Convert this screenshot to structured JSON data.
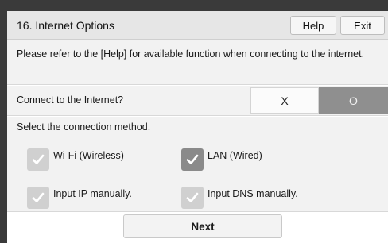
{
  "header": {
    "title": "16. Internet Options",
    "help_label": "Help",
    "exit_label": "Exit"
  },
  "info": {
    "text": "Please refer to the [Help] for available function when connecting to the internet."
  },
  "connect": {
    "label": "Connect to the Internet?",
    "off_label": "X",
    "on_label": "O",
    "selected": "O"
  },
  "method": {
    "label": "Select the connection method.",
    "options": [
      {
        "label": "Wi-Fi (Wireless)",
        "checked": false
      },
      {
        "label": "LAN (Wired)",
        "checked": true
      },
      {
        "label": "Input IP manually.",
        "checked": false
      },
      {
        "label": "Input DNS manually.",
        "checked": false
      }
    ]
  },
  "footer": {
    "next_label": "Next"
  },
  "colors": {
    "frame": "#3a3a3a",
    "panel": "#f2f2f2",
    "selected_toggle": "#8f8f8f",
    "checked_box": "#8a8a8a",
    "unchecked_box": "#d0d0d0"
  }
}
